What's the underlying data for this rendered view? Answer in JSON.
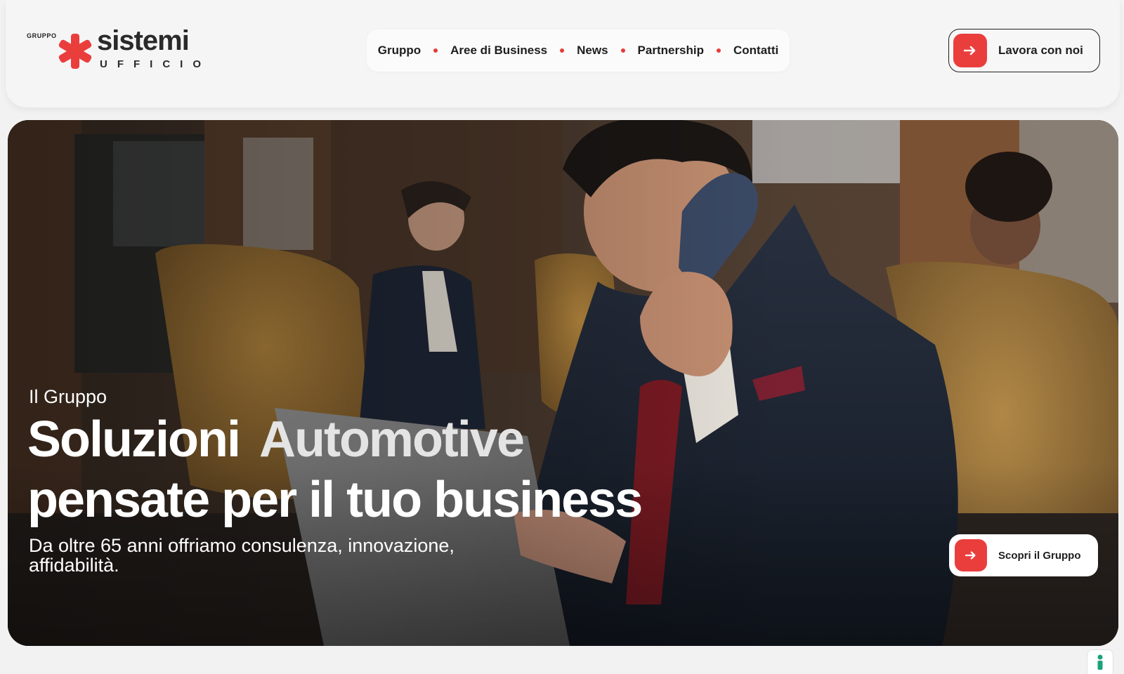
{
  "brand": {
    "prefix": "GRUPPO",
    "name": "sistemi",
    "sub": "UFFICIO",
    "accent": "#ea3e3d"
  },
  "nav": {
    "items": [
      {
        "label": "Gruppo"
      },
      {
        "label": "Aree di Business"
      },
      {
        "label": "News"
      },
      {
        "label": "Partnership"
      },
      {
        "label": "Contatti"
      }
    ]
  },
  "header": {
    "cta_label": "Lavora con noi",
    "cta_icon": "arrow-right-icon"
  },
  "hero": {
    "eyebrow": "Il Gruppo",
    "headline_part1": "Soluzioni",
    "headline_highlight": "Automotive",
    "headline_part2": "pensate per il tuo business",
    "subline": "Da oltre 65 anni offriamo consulenza, innovazione, affidabilità.",
    "cta_label": "Scopri il Gruppo",
    "cta_icon": "arrow-right-icon",
    "image": "business-man-on-phone-with-laptop-photo"
  },
  "widget": {
    "icon": "accessibility-icon",
    "color": "#1aa37a"
  }
}
